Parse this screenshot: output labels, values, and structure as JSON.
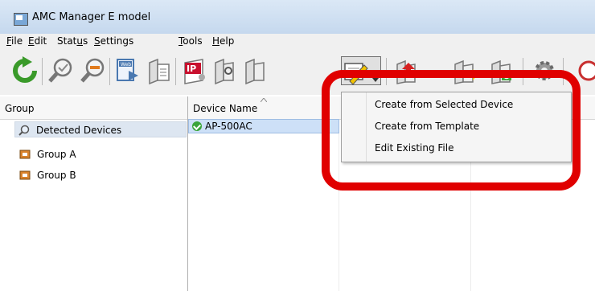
{
  "window": {
    "title": "AMC Manager E model"
  },
  "menu": [
    {
      "label": "File",
      "u": "F",
      "rest": "ile"
    },
    {
      "label": "Edit",
      "u": "E",
      "rest": "dit"
    },
    {
      "label": "Status",
      "pre": "Stat",
      "u": "u",
      "rest": "s"
    },
    {
      "label": "Settings",
      "u": "S",
      "rest": "ettings"
    },
    {
      "label": "Tools",
      "u": "T",
      "rest": "ools"
    },
    {
      "label": "Help",
      "u": "H",
      "rest": "elp"
    }
  ],
  "toolbar": {
    "web_label": "Web",
    "ip_label": "IP",
    "icons": [
      "refresh-icon",
      "search-icon",
      "search-remove-icon",
      "web-export-icon",
      "device-doc-icon",
      "ip-setting-icon",
      "device-settings-icon",
      "device-settings-2-icon",
      "config-edit-icon",
      "upload-icon",
      "device-transfer-icon",
      "device-power-icon",
      "gear-icon"
    ]
  },
  "left_pane": {
    "header": "Group",
    "items": [
      {
        "label": "Detected Devices",
        "icon": "magnifier-icon"
      },
      {
        "label": "Group A",
        "icon": "group-icon"
      },
      {
        "label": "Group B",
        "icon": "group-icon"
      }
    ]
  },
  "right_pane": {
    "header": "Device Name",
    "rows": [
      {
        "name": "AP-500AC",
        "status_icon": "ok-check-icon"
      }
    ]
  },
  "dropdown": {
    "items": [
      "Create from Selected Device",
      "Create from Template",
      "Edit Existing File"
    ]
  },
  "colors": {
    "highlight": "#e00000",
    "selection": "#cde0f7"
  }
}
